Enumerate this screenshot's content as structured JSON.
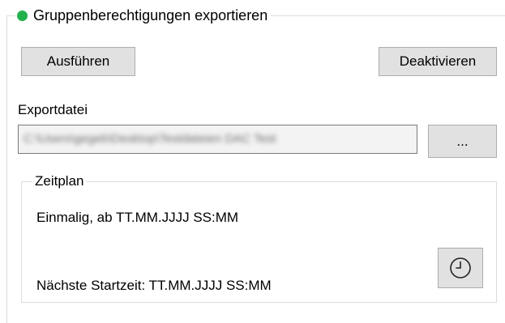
{
  "group": {
    "title": "Gruppenberechtigungen exportieren",
    "status_color": "#22b14c"
  },
  "buttons": {
    "run_label": "Ausführen",
    "deactivate_label": "Deaktivieren",
    "browse_label": "..."
  },
  "export": {
    "label": "Exportdatei",
    "value": "C:\\Users\\gegeb\\Desktop\\Testdateien DAC Test"
  },
  "schedule": {
    "title": "Zeitplan",
    "once_text": "Einmalig, ab TT.MM.JJJJ SS:MM",
    "next_text": "Nächste Startzeit: TT.MM.JJJJ SS:MM",
    "clock_icon": "clock-icon"
  }
}
